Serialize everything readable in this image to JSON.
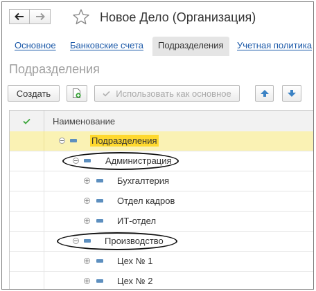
{
  "window": {
    "title": "Новое Дело (Организация)",
    "back_icon": "arrow-left-icon",
    "forward_icon": "arrow-right-icon",
    "favorite_icon": "star-icon"
  },
  "tabs": [
    {
      "label": "Основное",
      "active": false
    },
    {
      "label": "Банковские счета",
      "active": false
    },
    {
      "label": "Подразделения",
      "active": true
    },
    {
      "label": "Учетная политика",
      "active": false
    }
  ],
  "section": {
    "title": "Подразделения"
  },
  "toolbar": {
    "create_label": "Создать",
    "copy_icon": "add-copy-icon",
    "use_as_main_label": "Использовать как основное",
    "move_up_icon": "arrow-up-icon",
    "move_down_icon": "arrow-down-icon"
  },
  "table": {
    "columns": [
      "Наименование"
    ],
    "rows": [
      {
        "label": "Подразделения",
        "level": 0,
        "expander": "minus",
        "selected": true
      },
      {
        "label": "Администрация",
        "level": 1,
        "expander": "minus",
        "selected": false,
        "circled": true
      },
      {
        "label": "Бухгалтерия",
        "level": 2,
        "expander": "plus",
        "selected": false
      },
      {
        "label": "Отдел кадров",
        "level": 2,
        "expander": "plus",
        "selected": false
      },
      {
        "label": "ИТ-отдел",
        "level": 2,
        "expander": "plus",
        "selected": false
      },
      {
        "label": "Производство",
        "level": 1,
        "expander": "minus",
        "selected": false,
        "circled": true
      },
      {
        "label": "Цех № 1",
        "level": 2,
        "expander": "plus",
        "selected": false
      },
      {
        "label": "Цех № 2",
        "level": 2,
        "expander": "plus",
        "selected": false
      }
    ]
  },
  "colors": {
    "accent_link": "#1a58a8",
    "selected_row": "#faf2b4",
    "highlight": "#ffd92e",
    "arrow_button": "#3b82c4"
  }
}
